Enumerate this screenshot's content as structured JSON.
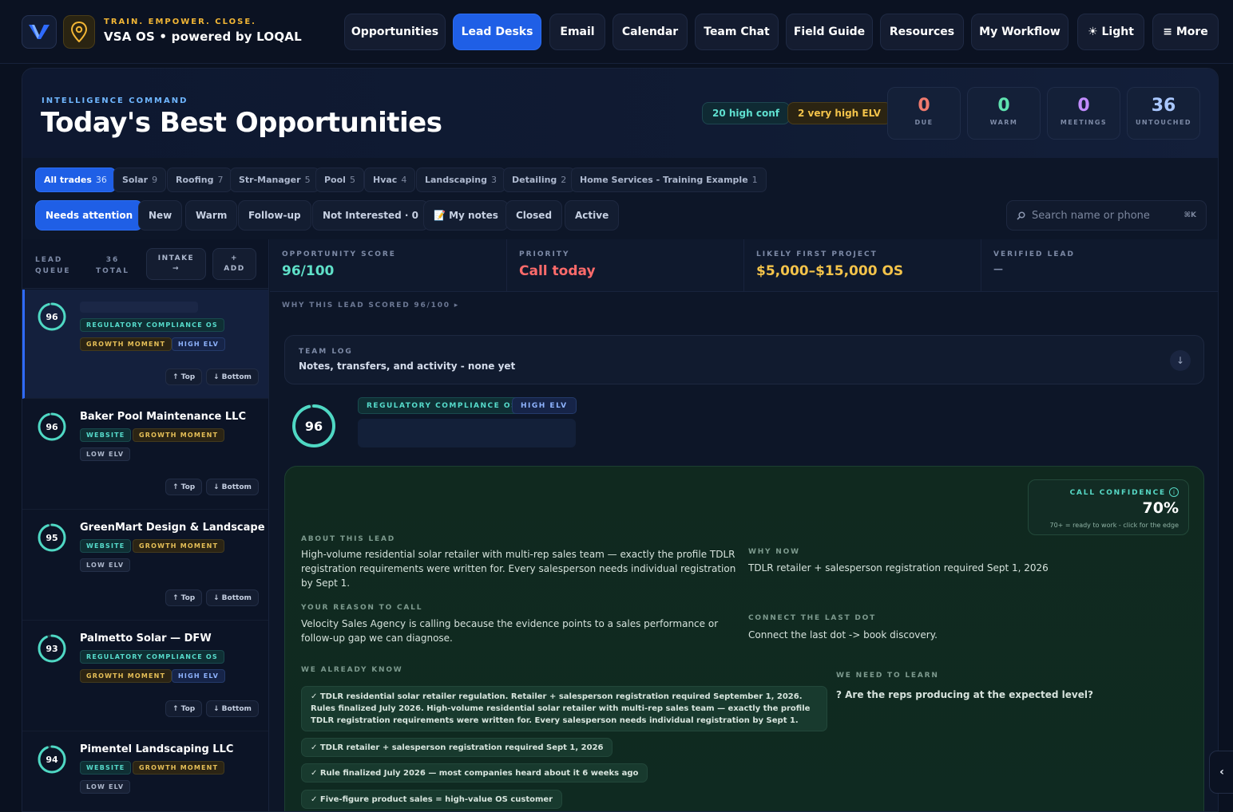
{
  "brand": {
    "tagline": "TRAIN. EMPOWER. CLOSE.",
    "name": "VSA OS • powered by LOQAL"
  },
  "nav": [
    {
      "label": "Opportunities"
    },
    {
      "label": "Lead Desks"
    },
    {
      "label": "Email"
    },
    {
      "label": "Calendar"
    },
    {
      "label": "Team Chat"
    },
    {
      "label": "Field Guide"
    },
    {
      "label": "Resources"
    },
    {
      "label": "My Workflow"
    },
    {
      "label": "☀ Light"
    },
    {
      "label": "≡ More"
    }
  ],
  "hero": {
    "eyebrow": "INTELLIGENCE COMMAND",
    "title": "Today's Best Opportunities",
    "high_conf": "20 high conf",
    "very_high_elv": "2 very high ELV"
  },
  "stats": [
    {
      "value": "0",
      "label": "DUE",
      "color": "#f07a6e"
    },
    {
      "value": "0",
      "label": "WARM",
      "color": "#5fe3b0"
    },
    {
      "value": "0",
      "label": "MEETINGS",
      "color": "#c28cff"
    },
    {
      "value": "36",
      "label": "UNTOUCHED",
      "color": "#a9c7ff"
    }
  ],
  "trades": [
    {
      "label": "All trades",
      "count": "36"
    },
    {
      "label": "Solar",
      "count": "9"
    },
    {
      "label": "Roofing",
      "count": "7"
    },
    {
      "label": "Str-Manager",
      "count": "5"
    },
    {
      "label": "Pool",
      "count": "5"
    },
    {
      "label": "Hvac",
      "count": "4"
    },
    {
      "label": "Landscaping",
      "count": "3"
    },
    {
      "label": "Detailing",
      "count": "2"
    },
    {
      "label": "Home Services - Training Example",
      "count": "1"
    }
  ],
  "filters": [
    {
      "label": "Needs attention"
    },
    {
      "label": "New"
    },
    {
      "label": "Warm"
    },
    {
      "label": "Follow-up"
    },
    {
      "label": "Not Interested · 0"
    },
    {
      "label": "📝 My notes"
    },
    {
      "label": "Closed"
    },
    {
      "label": "Active"
    }
  ],
  "search": {
    "placeholder": "Search name or phone",
    "shortcut": "⌘K"
  },
  "queue": {
    "label_line1": "LEAD",
    "label_line2": "QUEUE",
    "total_line1": "36",
    "total_line2": "TOTAL",
    "intake_line1": "INTAKE",
    "intake_line2": "→",
    "add_line1": "+",
    "add_line2": "ADD",
    "move_top": "↑ Top",
    "move_bottom": "↓ Bottom",
    "leads": [
      {
        "score": "96",
        "score_pct": 0.96,
        "name": "",
        "tags": [
          "REGULATORY COMPLIANCE OS",
          "GROWTH MOMENT",
          "HIGH ELV"
        ]
      },
      {
        "score": "96",
        "score_pct": 0.96,
        "name": "Baker Pool Maintenance LLC",
        "tags": [
          "WEBSITE",
          "GROWTH MOMENT",
          "LOW ELV"
        ]
      },
      {
        "score": "95",
        "score_pct": 0.95,
        "name": "GreenMart Design & Landscape",
        "tags": [
          "WEBSITE",
          "GROWTH MOMENT",
          "LOW ELV"
        ]
      },
      {
        "score": "93",
        "score_pct": 0.93,
        "name": "Palmetto Solar — DFW",
        "tags": [
          "REGULATORY COMPLIANCE OS",
          "GROWTH MOMENT",
          "HIGH ELV"
        ]
      },
      {
        "score": "94",
        "score_pct": 0.94,
        "name": "Pimentel Landscaping LLC",
        "tags": [
          "WEBSITE",
          "GROWTH MOMENT",
          "LOW ELV"
        ]
      }
    ]
  },
  "metrics": [
    {
      "label": "OPPORTUNITY SCORE",
      "value": "96/100",
      "color": "#5fe0c8"
    },
    {
      "label": "PRIORITY",
      "value": "Call today",
      "color": "#ff6b6b"
    },
    {
      "label": "LIKELY FIRST PROJECT",
      "value": "$5,000–$15,000 OS",
      "color": "#f3c34a"
    },
    {
      "label": "VERIFIED LEAD",
      "value": "—",
      "color": "#7d8aa6"
    }
  ],
  "why_scored": "WHY THIS LEAD SCORED 96/100 ▸",
  "team_log": {
    "label": "TEAM LOG",
    "text": "Notes, transfers, and activity - none yet",
    "toggle": "↓"
  },
  "detail": {
    "score": "96",
    "score_pct": 0.96,
    "tags": [
      "REGULATORY COMPLIANCE OS",
      "HIGH ELV"
    ],
    "confidence": {
      "label": "CALL CONFIDENCE",
      "info": "i",
      "value": "70%",
      "sub": "70+ = ready to work - click for the edge"
    },
    "about_label": "ABOUT THIS LEAD",
    "about_text": "High-volume residential solar retailer with multi-rep sales team — exactly the profile TDLR registration requirements were written for. Every salesperson needs individual registration by Sept 1.",
    "why_now_label": "WHY NOW",
    "why_now_text": "TDLR retailer + salesperson registration required Sept 1, 2026",
    "reason_label": "YOUR REASON TO CALL",
    "reason_text": "Velocity Sales Agency is calling because the evidence points to a sales performance or follow-up gap we can diagnose.",
    "connect_label": "CONNECT THE LAST DOT",
    "connect_text": "Connect the last dot -> book discovery.",
    "know_label": "WE ALREADY KNOW",
    "know_items": [
      "✓ TDLR residential solar retailer regulation. Retailer + salesperson registration required September 1, 2026. Rules finalized July 2026. High-volume residential solar retailer with multi-rep sales team — exactly the profile TDLR registration requirements were written for. Every salesperson needs individual registration by Sept 1.",
      "✓ TDLR retailer + salesperson registration required Sept 1, 2026",
      "✓ Rule finalized July 2026 — most companies heard about it 6 weeks ago",
      "✓ Five-figure product sales = high-value OS customer"
    ],
    "learn_label": "WE NEED TO LEARN",
    "learn_text": "? Are the reps producing at the expected level?"
  },
  "side_toggle": "‹"
}
